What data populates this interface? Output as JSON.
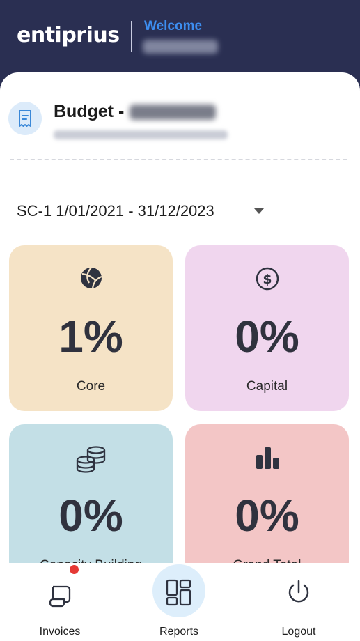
{
  "header": {
    "logo_text": "entiprius",
    "welcome_label": "Welcome"
  },
  "budget": {
    "title": "Budget -"
  },
  "period": {
    "selected": "SC-1 1/01/2021 - 31/12/2023"
  },
  "tiles": [
    {
      "percent": "1%",
      "label": "Core",
      "icon": "volleyball-icon",
      "color": "#f5e3c6"
    },
    {
      "percent": "0%",
      "label": "Capital",
      "icon": "dollar-circle-icon",
      "color": "#f0d6ee"
    },
    {
      "percent": "0%",
      "label": "Capacity Building",
      "icon": "coin-stack-icon",
      "color": "#c3dfe6"
    },
    {
      "percent": "0%",
      "label": "Grand Total",
      "icon": "bar-chart-icon",
      "color": "#f3c6c6"
    }
  ],
  "bottom_nav": {
    "invoices_label": "Invoices",
    "reports_label": "Reports",
    "logout_label": "Logout"
  },
  "colors": {
    "header_bg": "#2a2f52",
    "welcome": "#3d8ef0",
    "badge": "#e53935"
  }
}
